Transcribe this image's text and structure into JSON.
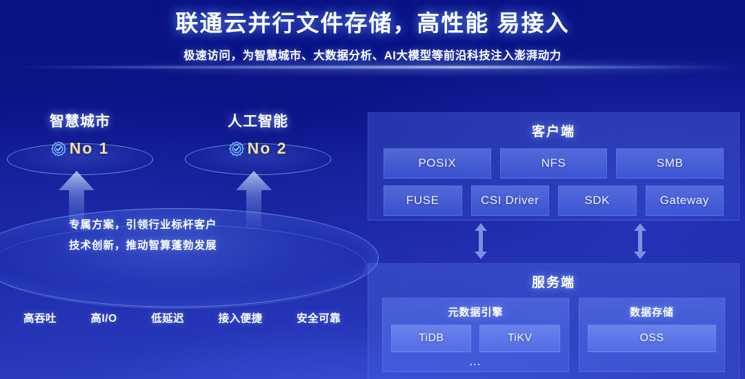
{
  "header": {
    "title": "联通云并行文件存储，高性能 易接入",
    "subtitle": "极速访问，为智慧城市、大数据分析、AI大模型等前沿科技注入澎湃动力"
  },
  "left_scene": {
    "pods": [
      {
        "label": "智慧城市",
        "rank": "No 1",
        "badge_icon": "verified-badge-icon"
      },
      {
        "label": "人工智能",
        "rank": "No 2",
        "badge_icon": "verified-badge-icon"
      }
    ],
    "pitch_lines": [
      "专属方案，引领行业标杆客户",
      "技术创新，推动智算蓬勃发展"
    ],
    "tags": [
      "高吞吐",
      "高I/O",
      "低延迟",
      "接入便捷",
      "安全可靠"
    ]
  },
  "client_panel": {
    "title": "客户端",
    "row1": [
      "POSIX",
      "NFS",
      "SMB"
    ],
    "row2": [
      "FUSE",
      "CSI Driver",
      "SDK",
      "Gateway"
    ]
  },
  "server_panel": {
    "title": "服务端",
    "metadata_engine": {
      "title": "元数据引擎",
      "items": [
        "TiDB",
        "TiKV"
      ],
      "more": "..."
    },
    "data_storage": {
      "title": "数据存储",
      "items": [
        "OSS"
      ]
    }
  },
  "colors": {
    "background_deep": "#0a1282",
    "background_light": "#2a3ab8",
    "accent_gold": "#f2dfa4",
    "chip_fill": "#6a8af0",
    "text_primary": "#ffffff"
  }
}
